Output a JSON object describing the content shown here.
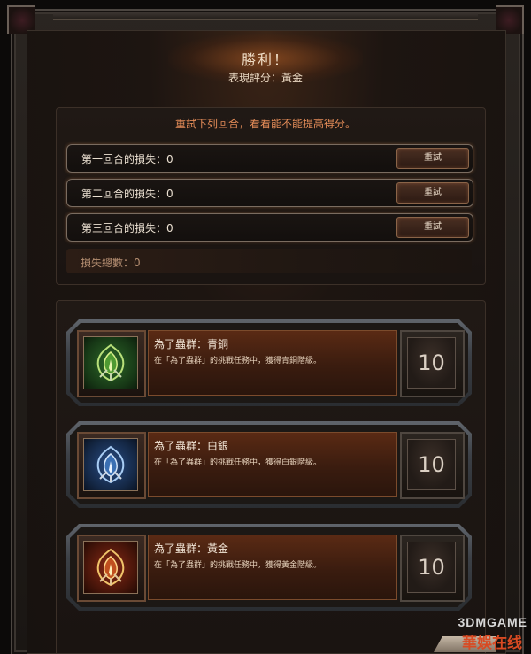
{
  "header": {
    "title": "勝利！",
    "subtitle": "表現評分：黃金"
  },
  "retry": {
    "instruction": "重試下列回合，看看能不能提高得分。",
    "rounds": [
      {
        "label": "第一回合的損失：0",
        "button": "重試"
      },
      {
        "label": "第二回合的損失：0",
        "button": "重試"
      },
      {
        "label": "第三回合的損失：0",
        "button": "重試"
      }
    ],
    "total_loss": "損失總數：0"
  },
  "achievements": [
    {
      "name": "為了蟲群：青銅",
      "description": "在「為了蟲群」的挑戰任務中，獲得青銅階級。",
      "points": "10",
      "icon": "zerg-emblem-bronze-icon",
      "accent": "#3fa84a"
    },
    {
      "name": "為了蟲群：白銀",
      "description": "在「為了蟲群」的挑戰任務中，獲得白銀階級。",
      "points": "10",
      "icon": "zerg-emblem-silver-icon",
      "accent": "#4a86d6"
    },
    {
      "name": "為了蟲群：黃金",
      "description": "在「為了蟲群」的挑戰任務中，獲得黃金階級。",
      "points": "10",
      "icon": "zerg-emblem-gold-icon",
      "accent": "#e04a2a"
    }
  ],
  "watermark": {
    "line1": "3DMGAME",
    "line2": "華娛在线"
  }
}
